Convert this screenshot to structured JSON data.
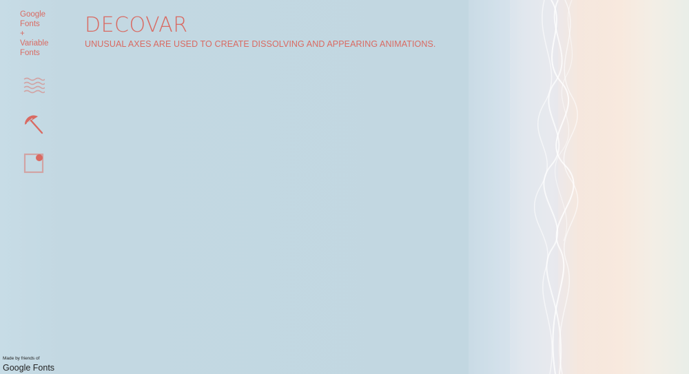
{
  "brand": {
    "name": "Google\nFonts\n+\nVariable\nFonts"
  },
  "nav": {
    "items": [
      {
        "icon": "waves-icon"
      },
      {
        "icon": "beach-umbrella-icon"
      },
      {
        "icon": "square-corner-dot-icon"
      }
    ]
  },
  "header": {
    "title": "DECOVAR",
    "subtitle": "UNUSUAL AXES ARE USED TO CREATE DISSOLVING AND APPEARING ANIMATIONS."
  },
  "footer": {
    "made_by": "Made by friends of",
    "brand": "Google Fonts"
  },
  "colors": {
    "accent": "#d96a62",
    "background": "#c3d8e2",
    "icon_muted": "#d2a3a3"
  }
}
